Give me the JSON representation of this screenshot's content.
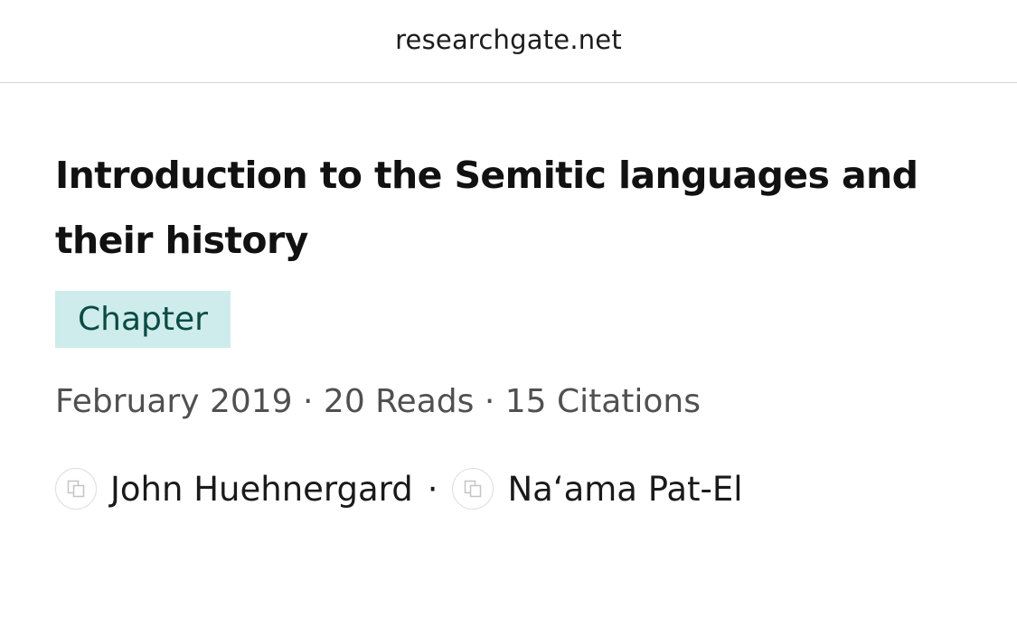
{
  "browser": {
    "url": "researchgate.net"
  },
  "publication": {
    "title": "Introduction to the Semitic languages and their history",
    "type_badge": "Chapter",
    "meta": "February 2019 · 20 Reads · 15 Citations",
    "authors": [
      {
        "name": "John Huehnergard",
        "avatar_icon": "placeholder-avatar-icon"
      },
      {
        "name": "Na‘ama Pat-El",
        "avatar_icon": "placeholder-avatar-icon"
      }
    ],
    "author_separator": "·"
  },
  "colors": {
    "badge_background": "#cdeceb",
    "badge_text": "#0b4a45",
    "meta_text": "#505050"
  }
}
